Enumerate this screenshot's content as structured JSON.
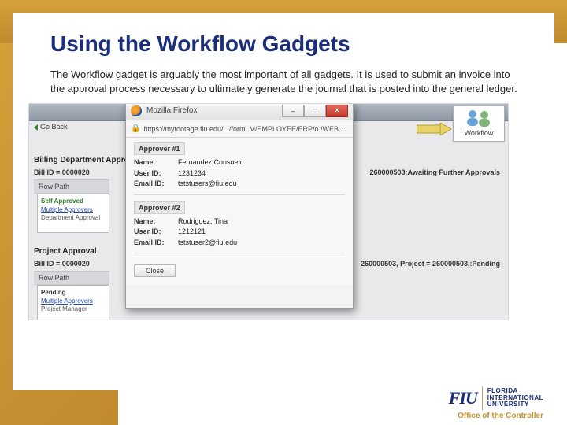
{
  "slide": {
    "title": "Using the Workflow Gadgets",
    "paragraph": "The Workflow gadget is arguably the most important of all gadgets. It is used to submit an invoice into the approval process necessary to ultimately generate the journal that is posted into the general ledger."
  },
  "screenshot": {
    "go_back": "Go Back",
    "workflow_tile_label": "Workflow",
    "section1": {
      "heading": "Billing Department Approval",
      "bill_left": "Bill ID = 0000020",
      "bill_right": "260000503:Awaiting Further Approvals",
      "row_path": "Row Path",
      "status_title": "Self Approved",
      "status_link": "Multiple Approvers",
      "status_sub": "Department Approval"
    },
    "section2": {
      "heading": "Project Approval",
      "bill_left": "Bill ID = 0000020",
      "bill_right": "260000503, Project = 260000503,:Pending",
      "row_path": "Row Path",
      "status_title": "Pending",
      "status_link": "Multiple Approvers",
      "status_sub": "Project Manager"
    }
  },
  "popup": {
    "window_title": "Mozilla Firefox",
    "url": "https://myfootage.fiu.edu/.../form..M/EMPLOYEE/ERP/o./WEBLIB_EC",
    "approver1": {
      "head": "Approver #1",
      "name_k": "Name:",
      "name_v": "Fernandez,Consuelo",
      "user_k": "User ID:",
      "user_v": "1231234",
      "email_k": "Email ID:",
      "email_v": "tststusers@fiu.edu"
    },
    "approver2": {
      "head": "Approver #2",
      "name_k": "Name:",
      "name_v": "Rodriguez, Tina",
      "user_k": "User ID:",
      "user_v": "1212121",
      "email_k": "Email ID:",
      "email_v": "tststuser2@fiu.edu"
    },
    "close": "Close"
  },
  "footer": {
    "fiu_mark": "FIU",
    "fiu_line1": "FLORIDA",
    "fiu_line2": "INTERNATIONAL",
    "fiu_line3": "UNIVERSITY",
    "office": "Office of the Controller"
  }
}
